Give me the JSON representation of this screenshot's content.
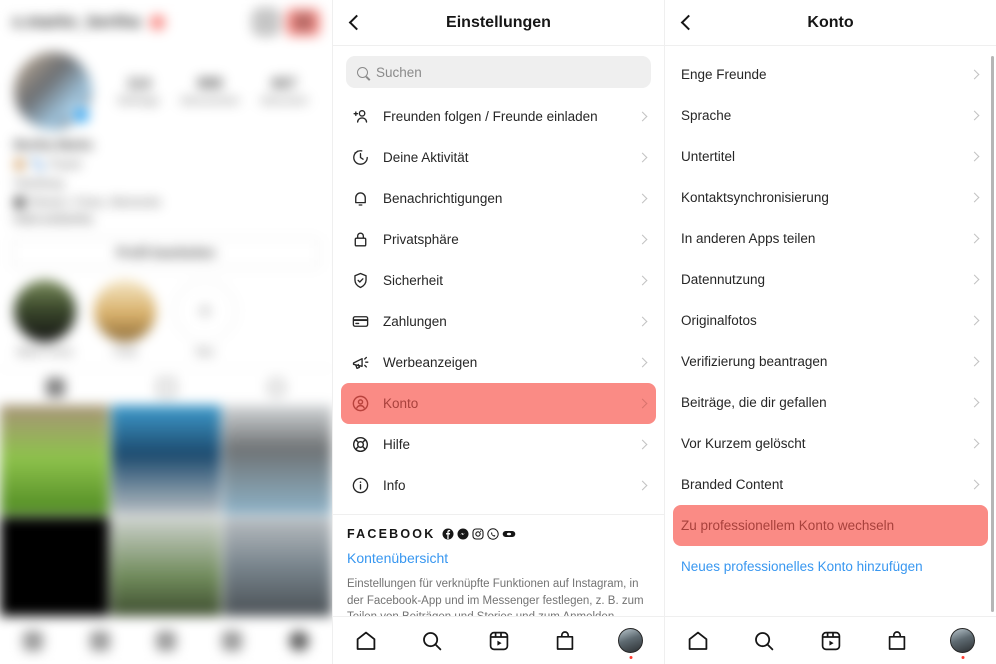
{
  "profile": {
    "username": "x.marks_bertha",
    "has_story_dot": true,
    "plus_icon": "add-post-icon",
    "menu_icon": "hamburger-menu-icon",
    "stats": [
      {
        "value": "114",
        "label": "Beiträge"
      },
      {
        "value": "888",
        "label": "Abonnenten"
      },
      {
        "value": "667",
        "label": "Abonniert"
      }
    ],
    "bio": {
      "name": "Bertha Marks",
      "line1": "🐾 Travel",
      "line2": "Hamburg",
      "line3": "Reisen, Fotos, Momente",
      "link": "linktr.ee/bertha"
    },
    "edit_button": "Profil bearbeiten",
    "highlights": [
      {
        "label": "Black Forest",
        "type": "photo"
      },
      {
        "label": "Food",
        "type": "photo"
      },
      {
        "label": "Neu",
        "type": "new"
      }
    ],
    "tabs": [
      "grid-tab",
      "reels-tab",
      "tagged-tab"
    ],
    "nav": [
      "home-icon",
      "search-icon",
      "reels-icon",
      "shop-icon",
      "profile-avatar"
    ]
  },
  "settings": {
    "title": "Einstellungen",
    "back_icon": "chevron-left-icon",
    "search": {
      "placeholder": "Suchen",
      "icon": "search-icon"
    },
    "items": [
      {
        "label": "Freunden folgen / Freunde einladen",
        "icon": "add-person-icon",
        "highlighted": false
      },
      {
        "label": "Deine Aktivität",
        "icon": "activity-clock-icon",
        "highlighted": false
      },
      {
        "label": "Benachrichtigungen",
        "icon": "bell-icon",
        "highlighted": false
      },
      {
        "label": "Privatsphäre",
        "icon": "lock-icon",
        "highlighted": false
      },
      {
        "label": "Sicherheit",
        "icon": "shield-check-icon",
        "highlighted": false
      },
      {
        "label": "Zahlungen",
        "icon": "credit-card-icon",
        "highlighted": false
      },
      {
        "label": "Werbeanzeigen",
        "icon": "megaphone-icon",
        "highlighted": false
      },
      {
        "label": "Konto",
        "icon": "account-circle-icon",
        "highlighted": true
      },
      {
        "label": "Hilfe",
        "icon": "lifebuoy-icon",
        "highlighted": false
      },
      {
        "label": "Info",
        "icon": "info-circle-icon",
        "highlighted": false
      }
    ],
    "facebook": {
      "title": "FACEBOOK",
      "icons": [
        "facebook-icon",
        "messenger-icon",
        "instagram-icon",
        "whatsapp-icon",
        "oculus-icon"
      ],
      "link": "Kontenübersicht",
      "description": "Einstellungen für verknüpfte Funktionen auf Instagram, in der Facebook-App und im Messenger festlegen, z. B. zum Teilen von Beiträgen und Stories und zum Anmelden."
    }
  },
  "account": {
    "title": "Konto",
    "back_icon": "chevron-left-icon",
    "items": [
      {
        "label": "Enge Freunde",
        "type": "chevron",
        "highlighted": false
      },
      {
        "label": "Sprache",
        "type": "chevron",
        "highlighted": false
      },
      {
        "label": "Untertitel",
        "type": "chevron",
        "highlighted": false
      },
      {
        "label": "Kontaktsynchronisierung",
        "type": "chevron",
        "highlighted": false
      },
      {
        "label": "In anderen Apps teilen",
        "type": "chevron",
        "highlighted": false
      },
      {
        "label": "Datennutzung",
        "type": "chevron",
        "highlighted": false
      },
      {
        "label": "Originalfotos",
        "type": "chevron",
        "highlighted": false
      },
      {
        "label": "Verifizierung beantragen",
        "type": "chevron",
        "highlighted": false
      },
      {
        "label": "Beiträge, die dir gefallen",
        "type": "chevron",
        "highlighted": false
      },
      {
        "label": "Vor Kurzem gelöscht",
        "type": "chevron",
        "highlighted": false
      },
      {
        "label": "Branded Content",
        "type": "chevron",
        "highlighted": false
      },
      {
        "label": "Zu professionellem Konto wechseln",
        "type": "link",
        "highlighted": true
      },
      {
        "label": "Neues professionelles Konto hinzufügen",
        "type": "link",
        "highlighted": false
      }
    ]
  },
  "bottom_nav": [
    {
      "name": "home-icon"
    },
    {
      "name": "search-icon"
    },
    {
      "name": "reels-icon"
    },
    {
      "name": "shop-icon"
    },
    {
      "name": "profile-avatar"
    }
  ],
  "colors": {
    "highlight": "#fa8b85",
    "link_blue": "#3897f0",
    "text": "#262626",
    "muted": "#8a8a8a"
  }
}
